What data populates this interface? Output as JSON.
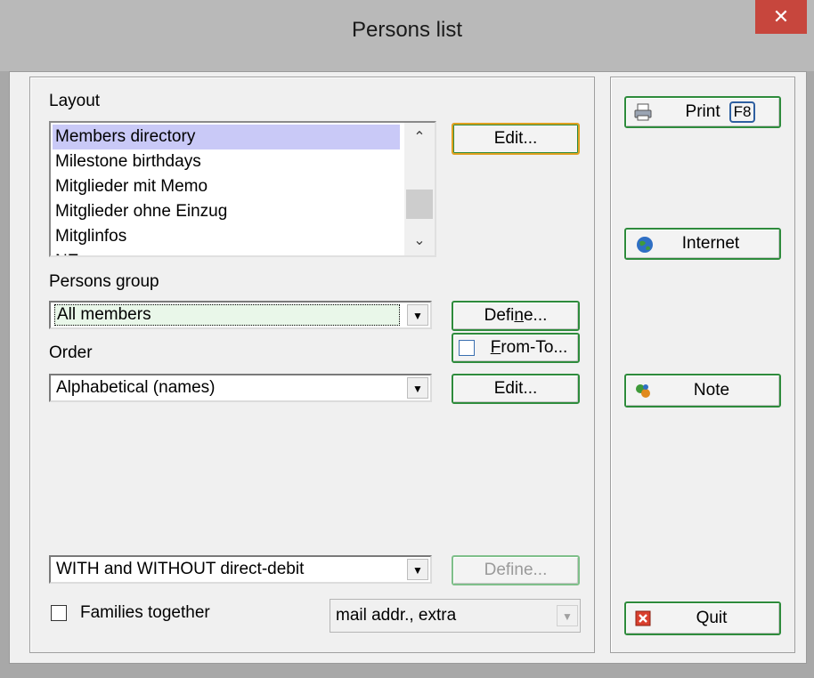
{
  "window": {
    "title": "Persons list",
    "close_symbol": "✕"
  },
  "layout": {
    "label": "Layout",
    "items": [
      "Members directory",
      "Milestone birthdays",
      "Mitglieder mit Memo",
      "Mitglieder ohne Einzug",
      "Mitglinfos",
      "NE"
    ],
    "selected": "Members directory",
    "edit_button": "Edit..."
  },
  "persons_group": {
    "label": "Persons group",
    "value": "All members",
    "define_button_pre": "Defi",
    "define_button_mnemonic": "n",
    "define_button_post": "e...",
    "from_to_mnemonic": "F",
    "from_to_rest": "rom-To..."
  },
  "order": {
    "label": "Order",
    "value": "Alphabetical (names)",
    "edit_button": "Edit..."
  },
  "debit": {
    "value": "WITH and WITHOUT direct-debit",
    "define_button": "Define..."
  },
  "families": {
    "label": "Families together",
    "checked": false
  },
  "mail": {
    "value": "mail addr., extra"
  },
  "sidebar": {
    "print_label": "Print",
    "print_shortcut": "F8",
    "internet_label": "Internet",
    "note_label": "Note",
    "quit_label": "Quit"
  },
  "colors": {
    "accent_border": "#2e8b3c",
    "default_border": "#e0a020",
    "close_bg": "#c7463d",
    "selection": "#c9c9f7"
  }
}
